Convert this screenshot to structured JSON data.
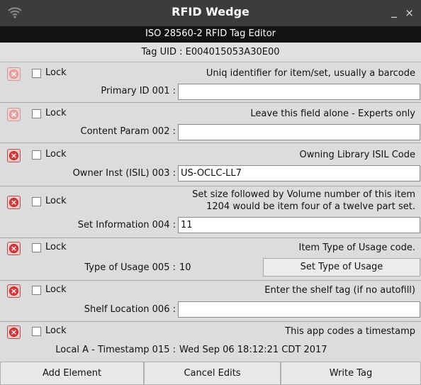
{
  "window": {
    "title": "RFID Wedge",
    "minimize": "_",
    "close": "×"
  },
  "editor": {
    "subtitle": "ISO 28560-2 RFID Tag Editor",
    "tag_uid_label": "Tag UID : ",
    "tag_uid_value": "E004015053A30E00"
  },
  "lock_label": "Lock",
  "sections": [
    {
      "description": "Uniq identifier for item/set, usually a barcode",
      "label": "Primary ID 001 :",
      "value": ""
    },
    {
      "description": "Leave this field alone - Experts only",
      "label": "Content Param 002 :",
      "value": ""
    },
    {
      "description": "Owning Library ISIL Code",
      "label": "Owner Inst (ISIL) 003 :",
      "value": "US-OCLC-LL7"
    },
    {
      "description_line1": "Set size followed by Volume number of this item",
      "description_line2": "1204 would be item four of a twelve part set.",
      "label": "Set Information 004 :",
      "value": "11"
    },
    {
      "description": "Item Type of Usage code.",
      "label": "Type of Usage 005 :",
      "value": "10",
      "button": "Set Type of Usage"
    },
    {
      "description": "Enter the shelf tag (if no autofill)",
      "label": "Shelf Location 006 :",
      "value": ""
    },
    {
      "description": "This app codes a timestamp",
      "label": "Local A - Timestamp 015 :",
      "value": "Wed Sep 06 18:12:21 CDT 2017"
    }
  ],
  "actions": {
    "add": "Add Element",
    "cancel": "Cancel Edits",
    "write": "Write Tag"
  }
}
